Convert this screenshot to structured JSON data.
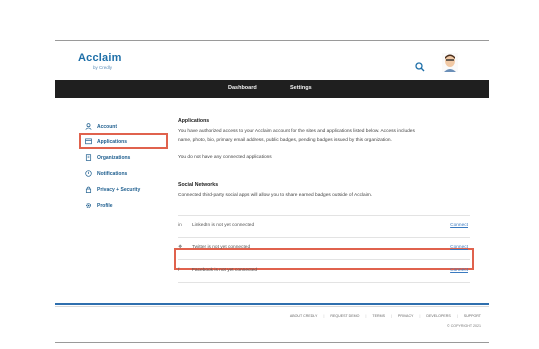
{
  "brand": {
    "name": "Acclaim",
    "tagline": "by Credly"
  },
  "nav": {
    "dashboard": "Dashboard",
    "settings": "Settings"
  },
  "sidebar": {
    "items": [
      {
        "label": "Account",
        "icon": "user-icon"
      },
      {
        "label": "Applications",
        "icon": "applications-icon"
      },
      {
        "label": "Organizations",
        "icon": "building-icon"
      },
      {
        "label": "Notifications",
        "icon": "bell-icon"
      },
      {
        "label": "Privacy + Security",
        "icon": "lock-icon"
      },
      {
        "label": "Profile",
        "icon": "gear-icon"
      }
    ]
  },
  "applications": {
    "title": "Applications",
    "description_line1": "You have authorized access to your Acclaim account for the sites and applications listed below. Access includes",
    "description_line2": "name, photo, bio, primary email address, public badges, pending badges issued by this organization.",
    "empty": "You do not have any connected applications"
  },
  "social": {
    "title": "Social Networks",
    "description": "Connected third-party social apps will allow you to share earned badges outside of Acclaim.",
    "networks": [
      {
        "icon": "in",
        "label": "LinkedIn is not yet connected",
        "action": "Connect"
      },
      {
        "icon": "❖",
        "label": "Twitter is not yet connected",
        "action": "Connect"
      },
      {
        "icon": "f",
        "label": "Facebook is not yet connected",
        "action": "Connect"
      }
    ]
  },
  "footer": {
    "links": [
      "ABOUT CREDLY",
      "REQUEST DEMO",
      "TERMS",
      "PRIVACY",
      "DEVELOPERS",
      "SUPPORT"
    ],
    "copyright": "© COPYRIGHT 2021"
  },
  "colors": {
    "brand": "#1e6fa8",
    "navbar": "#1f1f1f",
    "highlight": "#e0624d",
    "link": "#3a7ac0"
  }
}
